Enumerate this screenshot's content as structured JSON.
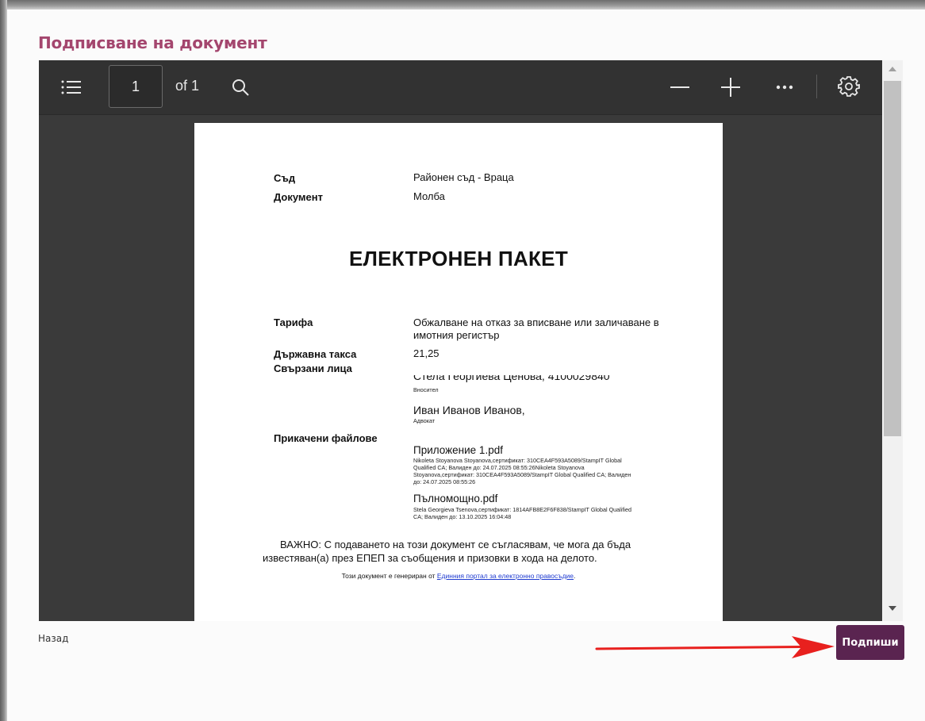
{
  "page": {
    "title": "Подписване на документ"
  },
  "toolbar": {
    "page_number": "1",
    "page_count": "of 1"
  },
  "document": {
    "court_label": "Съд",
    "court_value": "Районен съд - Враца",
    "doc_label": "Документ",
    "doc_value": "Молба",
    "heading": "ЕЛЕКТРОНЕН ПАКЕТ",
    "tariff_label": "Тарифа",
    "tariff_value_1": "Обжалване на отказ за вписване или заличаване в",
    "tariff_value_2": "имотния регистър",
    "fee_label": "Държавна такса",
    "fee_value": "21,25",
    "related_label": "Свързани лица",
    "person1_name": "Стела Георгиева Ценова, 4100029840",
    "person1_role": "Вносител",
    "person2_name": "Иван Иванов Иванов,",
    "person2_role": "Адвокат",
    "files_label": "Прикачени файлове",
    "file1_name": "Приложение 1.pdf",
    "file1_sig_1": "Nikoleta Stoyanova Stoyanova,сертификат: 310CEA4F593A5089/StampIT Global",
    "file1_sig_2": "Qualified CA; Валиден до: 24.07.2025 08:55:26Nikoleta Stoyanova",
    "file1_sig_3": "Stoyanova,сертификат: 310CEA4F593A5089/StampIT Global Qualified CA; Валиден",
    "file1_sig_4": "до: 24.07.2025 08:55:26",
    "file2_name": "Пълномощно.pdf",
    "file2_sig_1": "Stela Georgieva Tsenova,сертификат: 1814AFB8E2F6F838/StampIT Global Qualified",
    "file2_sig_2": "CA; Валиден до: 13.10.2025 16:04:48",
    "notice_1": "ВАЖНО: С подаването на този документ се съгласявам, че мога да бъда",
    "notice_2": "известяван(а) през ЕПЕП за съобщения и призовки в хода на делото.",
    "footer_prefix": "Този документ е генериран от ",
    "footer_link": "Единния портал за електронно правосъдие",
    "footer_suffix": "."
  },
  "actions": {
    "back_label": "Назад",
    "sign_label": "Подпиши"
  },
  "colors": {
    "title": "#a4466e",
    "sign_button": "#5a2450",
    "arrow": "#e8201e",
    "toolbar": "#323232"
  }
}
